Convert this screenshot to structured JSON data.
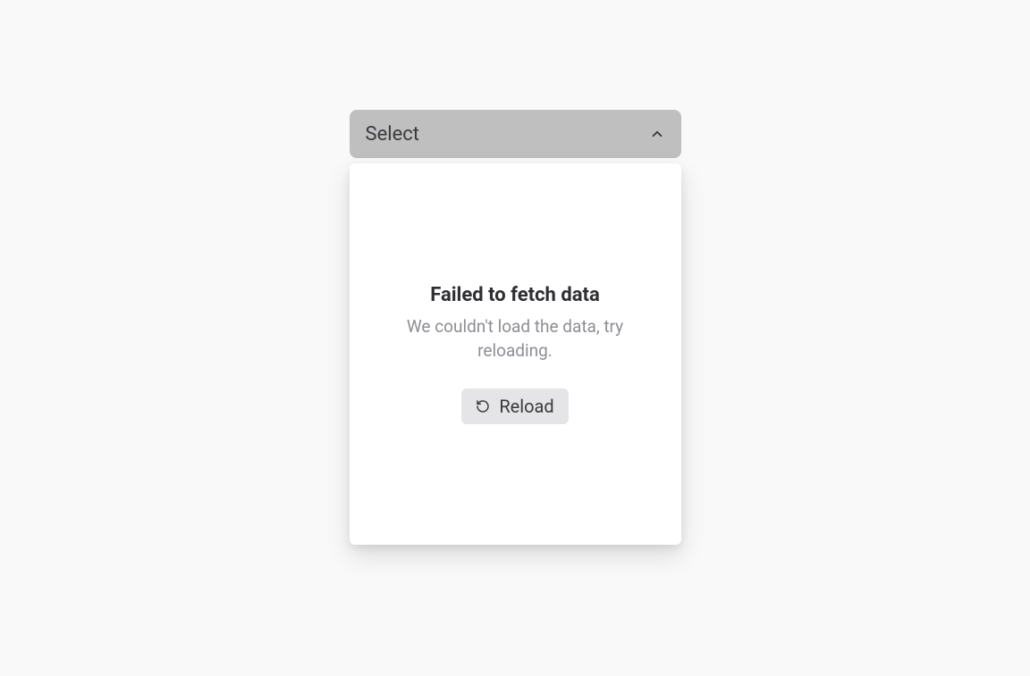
{
  "select": {
    "label": "Select"
  },
  "error": {
    "title": "Failed to fetch data",
    "subtitle": "We couldn't load the data, try reloading.",
    "reload_label": "Reload"
  }
}
